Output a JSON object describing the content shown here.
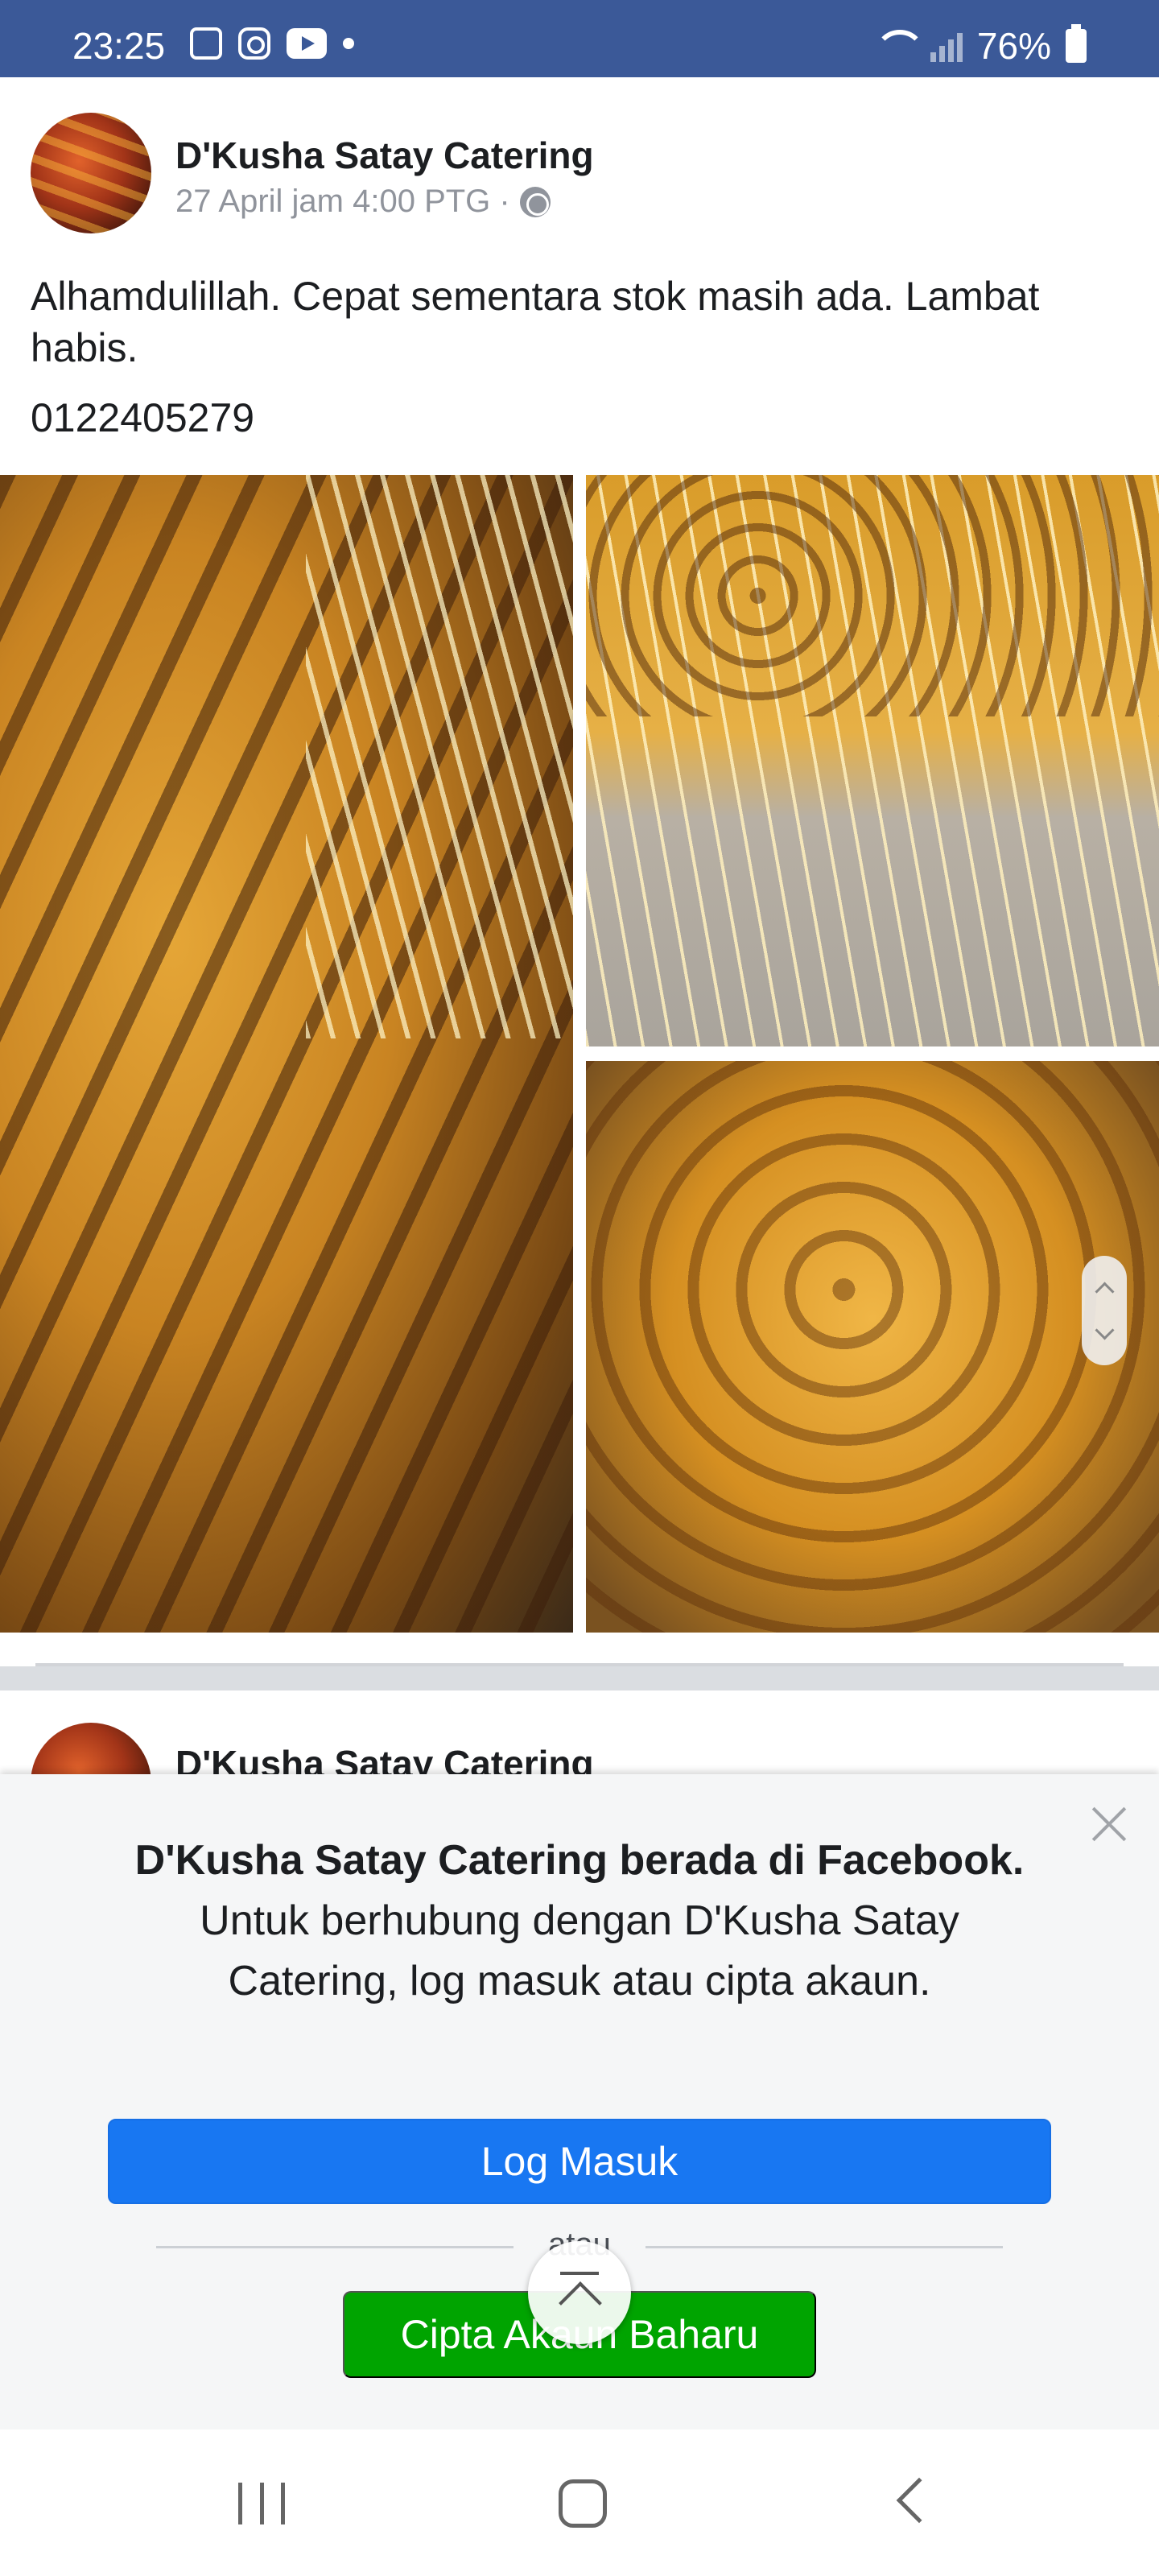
{
  "status_bar": {
    "time": "23:25",
    "battery": "76%",
    "icons": [
      "gallery-icon",
      "instagram-icon",
      "youtube-icon",
      "dot-icon",
      "wifi-icon",
      "signal-icon",
      "battery-icon"
    ],
    "background": "#3b5998"
  },
  "post": {
    "page_name": "D'Kusha Satay Catering",
    "timestamp": "27 April jam 4:00 PTG ·",
    "text": "Alhamdulillah. Cepat sementara stok masih ada. Lambat habis.",
    "phone": "0122405279"
  },
  "post2": {
    "page_name": "D'Kusha Satay Catering"
  },
  "dialog": {
    "bold_text": "D'Kusha Satay Catering berada di Facebook.",
    "text": " Untuk berhubung dengan D'Kusha Satay Catering, log masuk atau cipta akaun.",
    "login_label": "Log Masuk",
    "or_label": "atau",
    "signup_label": "Cipta Akaun Baharu",
    "login_color": "#1877f2",
    "signup_color": "#00a400"
  }
}
